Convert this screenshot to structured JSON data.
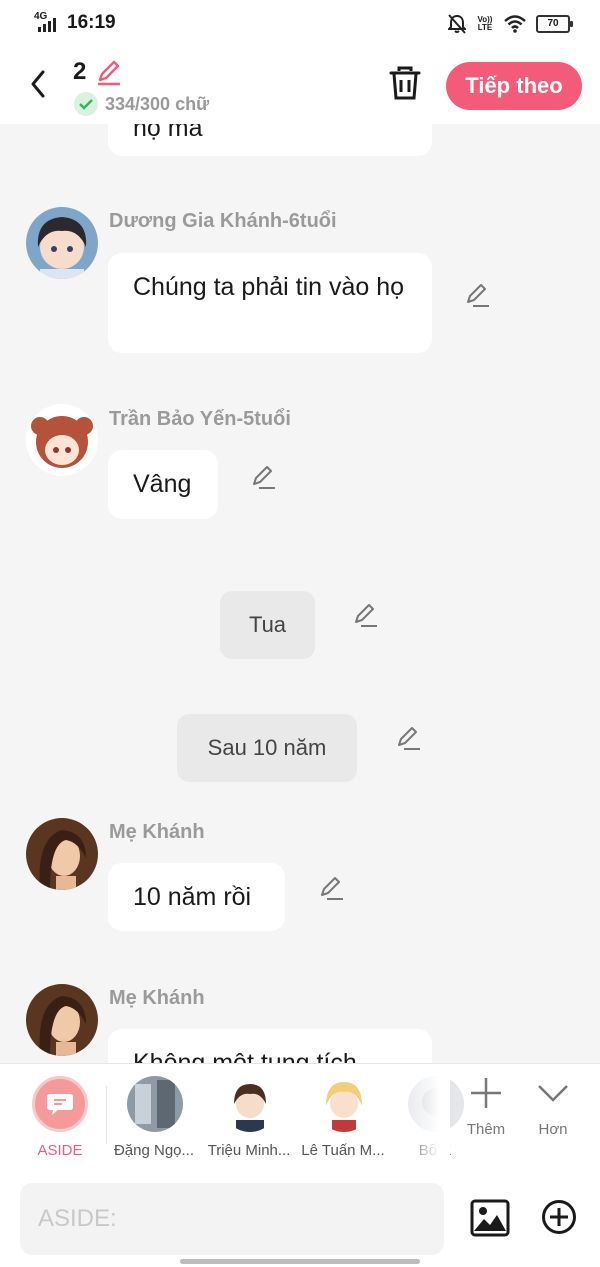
{
  "status_bar": {
    "network": "4G",
    "time": "16:19",
    "volte": "Vo)) LTE",
    "battery": "70"
  },
  "header": {
    "draft_number": "2",
    "word_count": "334/300 chữ",
    "next_button": "Tiếp theo"
  },
  "messages": [
    {
      "type": "character",
      "text": "họ mà"
    },
    {
      "type": "character",
      "name": "Dương Gia Khánh-6tuổi",
      "text": "Chúng ta phải tin vào họ"
    },
    {
      "type": "character",
      "name": "Trần Bảo Yến-5tuổi",
      "text": "Vâng"
    },
    {
      "type": "narration",
      "text": "Tua"
    },
    {
      "type": "narration",
      "text": "Sau 10 năm"
    },
    {
      "type": "character",
      "name": "Mẹ Khánh",
      "text": "10 năm rồi"
    },
    {
      "type": "character",
      "name": "Mẹ Khánh",
      "text": "Không một tung tích"
    }
  ],
  "characters": [
    {
      "label": "ASIDE"
    },
    {
      "label": "Đặng Ngọ..."
    },
    {
      "label": "Triệu Minh..."
    },
    {
      "label": "Lê Tuấn M..."
    },
    {
      "label": "Bố K"
    }
  ],
  "tools": {
    "add_label": "Thêm",
    "more_label": "Hơn"
  },
  "input": {
    "placeholder": "ASIDE:",
    "value": ""
  },
  "colors": {
    "accent": "#f45b79",
    "background": "#f5f5f5",
    "bubble": "#ffffff",
    "narration_bubble": "#e9e9e9",
    "success": "#2eb85c"
  }
}
